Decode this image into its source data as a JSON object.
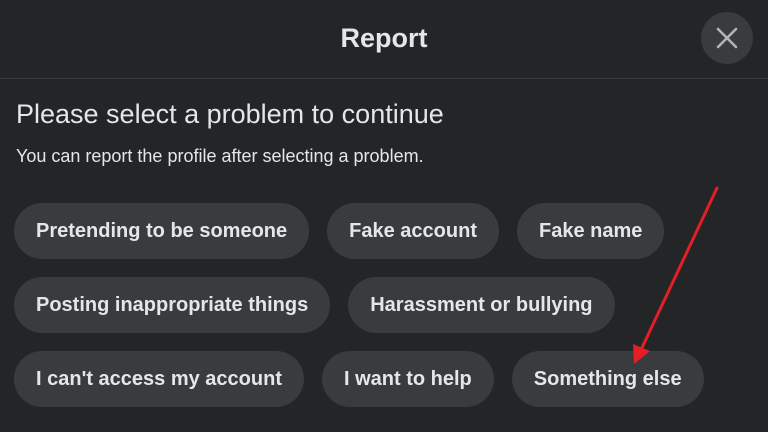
{
  "header": {
    "title": "Report",
    "close_icon": "close-icon"
  },
  "main": {
    "heading": "Please select a problem to continue",
    "subheading": "You can report the profile after selecting a problem.",
    "options": [
      [
        "Pretending to be someone",
        "Fake account",
        "Fake name"
      ],
      [
        "Posting inappropriate things",
        "Harassment or bullying"
      ],
      [
        "I can't access my account",
        "I want to help",
        "Something else"
      ]
    ]
  },
  "colors": {
    "background": "#242526",
    "chip": "#3a3b3c",
    "text": "#e4e6eb",
    "annotation_arrow": "#e41e26"
  }
}
